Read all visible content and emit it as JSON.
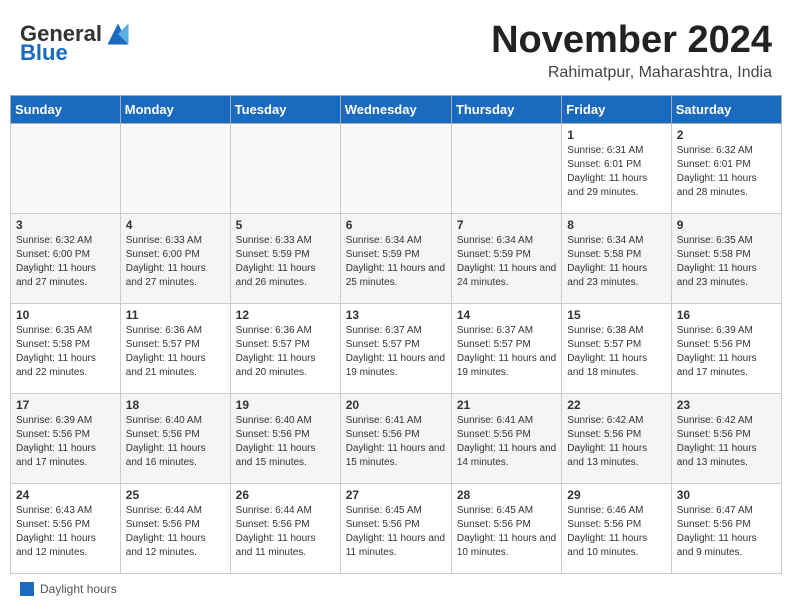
{
  "header": {
    "logo": {
      "general": "General",
      "blue": "Blue"
    },
    "title": "November 2024",
    "location": "Rahimatpur, Maharashtra, India"
  },
  "weekdays": [
    "Sunday",
    "Monday",
    "Tuesday",
    "Wednesday",
    "Thursday",
    "Friday",
    "Saturday"
  ],
  "weeks": [
    [
      {
        "day": "",
        "info": ""
      },
      {
        "day": "",
        "info": ""
      },
      {
        "day": "",
        "info": ""
      },
      {
        "day": "",
        "info": ""
      },
      {
        "day": "",
        "info": ""
      },
      {
        "day": "1",
        "info": "Sunrise: 6:31 AM\nSunset: 6:01 PM\nDaylight: 11 hours and 29 minutes."
      },
      {
        "day": "2",
        "info": "Sunrise: 6:32 AM\nSunset: 6:01 PM\nDaylight: 11 hours and 28 minutes."
      }
    ],
    [
      {
        "day": "3",
        "info": "Sunrise: 6:32 AM\nSunset: 6:00 PM\nDaylight: 11 hours and 27 minutes."
      },
      {
        "day": "4",
        "info": "Sunrise: 6:33 AM\nSunset: 6:00 PM\nDaylight: 11 hours and 27 minutes."
      },
      {
        "day": "5",
        "info": "Sunrise: 6:33 AM\nSunset: 5:59 PM\nDaylight: 11 hours and 26 minutes."
      },
      {
        "day": "6",
        "info": "Sunrise: 6:34 AM\nSunset: 5:59 PM\nDaylight: 11 hours and 25 minutes."
      },
      {
        "day": "7",
        "info": "Sunrise: 6:34 AM\nSunset: 5:59 PM\nDaylight: 11 hours and 24 minutes."
      },
      {
        "day": "8",
        "info": "Sunrise: 6:34 AM\nSunset: 5:58 PM\nDaylight: 11 hours and 23 minutes."
      },
      {
        "day": "9",
        "info": "Sunrise: 6:35 AM\nSunset: 5:58 PM\nDaylight: 11 hours and 23 minutes."
      }
    ],
    [
      {
        "day": "10",
        "info": "Sunrise: 6:35 AM\nSunset: 5:58 PM\nDaylight: 11 hours and 22 minutes."
      },
      {
        "day": "11",
        "info": "Sunrise: 6:36 AM\nSunset: 5:57 PM\nDaylight: 11 hours and 21 minutes."
      },
      {
        "day": "12",
        "info": "Sunrise: 6:36 AM\nSunset: 5:57 PM\nDaylight: 11 hours and 20 minutes."
      },
      {
        "day": "13",
        "info": "Sunrise: 6:37 AM\nSunset: 5:57 PM\nDaylight: 11 hours and 19 minutes."
      },
      {
        "day": "14",
        "info": "Sunrise: 6:37 AM\nSunset: 5:57 PM\nDaylight: 11 hours and 19 minutes."
      },
      {
        "day": "15",
        "info": "Sunrise: 6:38 AM\nSunset: 5:57 PM\nDaylight: 11 hours and 18 minutes."
      },
      {
        "day": "16",
        "info": "Sunrise: 6:39 AM\nSunset: 5:56 PM\nDaylight: 11 hours and 17 minutes."
      }
    ],
    [
      {
        "day": "17",
        "info": "Sunrise: 6:39 AM\nSunset: 5:56 PM\nDaylight: 11 hours and 17 minutes."
      },
      {
        "day": "18",
        "info": "Sunrise: 6:40 AM\nSunset: 5:56 PM\nDaylight: 11 hours and 16 minutes."
      },
      {
        "day": "19",
        "info": "Sunrise: 6:40 AM\nSunset: 5:56 PM\nDaylight: 11 hours and 15 minutes."
      },
      {
        "day": "20",
        "info": "Sunrise: 6:41 AM\nSunset: 5:56 PM\nDaylight: 11 hours and 15 minutes."
      },
      {
        "day": "21",
        "info": "Sunrise: 6:41 AM\nSunset: 5:56 PM\nDaylight: 11 hours and 14 minutes."
      },
      {
        "day": "22",
        "info": "Sunrise: 6:42 AM\nSunset: 5:56 PM\nDaylight: 11 hours and 13 minutes."
      },
      {
        "day": "23",
        "info": "Sunrise: 6:42 AM\nSunset: 5:56 PM\nDaylight: 11 hours and 13 minutes."
      }
    ],
    [
      {
        "day": "24",
        "info": "Sunrise: 6:43 AM\nSunset: 5:56 PM\nDaylight: 11 hours and 12 minutes."
      },
      {
        "day": "25",
        "info": "Sunrise: 6:44 AM\nSunset: 5:56 PM\nDaylight: 11 hours and 12 minutes."
      },
      {
        "day": "26",
        "info": "Sunrise: 6:44 AM\nSunset: 5:56 PM\nDaylight: 11 hours and 11 minutes."
      },
      {
        "day": "27",
        "info": "Sunrise: 6:45 AM\nSunset: 5:56 PM\nDaylight: 11 hours and 11 minutes."
      },
      {
        "day": "28",
        "info": "Sunrise: 6:45 AM\nSunset: 5:56 PM\nDaylight: 11 hours and 10 minutes."
      },
      {
        "day": "29",
        "info": "Sunrise: 6:46 AM\nSunset: 5:56 PM\nDaylight: 11 hours and 10 minutes."
      },
      {
        "day": "30",
        "info": "Sunrise: 6:47 AM\nSunset: 5:56 PM\nDaylight: 11 hours and 9 minutes."
      }
    ]
  ],
  "legend": {
    "label": "Daylight hours"
  }
}
